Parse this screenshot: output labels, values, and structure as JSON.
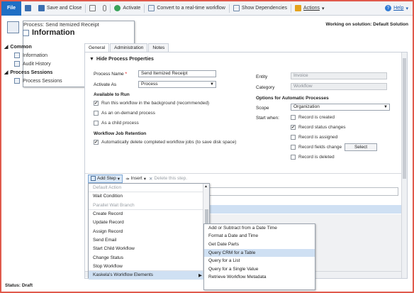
{
  "ribbon": {
    "file": "File",
    "save_close": "Save and Close",
    "activate": "Activate",
    "convert": "Convert to a real-time workflow",
    "dependencies": "Show Dependencies",
    "actions": "Actions",
    "help": "Help"
  },
  "header": {
    "subtitle": "Process: Send Itemized Receipt",
    "title": "Information",
    "solution": "Working on solution: Default Solution"
  },
  "nav": {
    "common": "Common",
    "information": "Information",
    "audit": "Audit History",
    "sessions_header": "Process Sessions",
    "sessions_item": "Process Sessions"
  },
  "tabs": [
    "General",
    "Administration",
    "Notes"
  ],
  "section": {
    "title": "Hide Process Properties"
  },
  "form": {
    "process_name_label": "Process Name",
    "process_name": "Send Itemized Receipt",
    "activate_as_label": "Activate As",
    "activate_as": "Process",
    "available_header": "Available to Run",
    "opt_background": "Run this workflow in the background (recommended)",
    "opt_ondemand": "As an on-demand process",
    "opt_child": "As a child process",
    "retention_header": "Workflow Job Retention",
    "opt_retention": "Automatically delete completed workflow jobs (to save disk space)",
    "entity_label": "Entity",
    "entity": "Invoice",
    "category_label": "Category",
    "category": "Workflow",
    "options_header": "Options for Automatic Processes",
    "scope_label": "Scope",
    "scope": "Organization",
    "start_label": "Start when:",
    "start_created": "Record is created",
    "start_status": "Record status changes",
    "start_assigned": "Record is assigned",
    "start_fields": "Record fields change",
    "select_btn": "Select",
    "start_deleted": "Record is deleted"
  },
  "steps": {
    "add_step": "Add Step",
    "insert": "Insert",
    "delete": "Delete this step."
  },
  "menu": [
    "Default Action",
    "Wait Condition",
    "Parallel Wait Branch",
    "Create Record",
    "Update Record",
    "Assign Record",
    "Send Email",
    "Start Child Workflow",
    "Change Status",
    "Stop Workflow",
    "Kaskela's Workflow Elements"
  ],
  "submenu": [
    "Add or Subtract from a Date Time",
    "Format a Date and Time",
    "Get Date Parts",
    "Query CRM for a Table",
    "Query for a List",
    "Query for a Single Value",
    "Retrieve Workflow Metadata"
  ],
  "status": "Status: Draft",
  "colors": {
    "accent": "#1f6fc5",
    "highlight": "#cfe0f3",
    "frame": "#e05a4c"
  }
}
